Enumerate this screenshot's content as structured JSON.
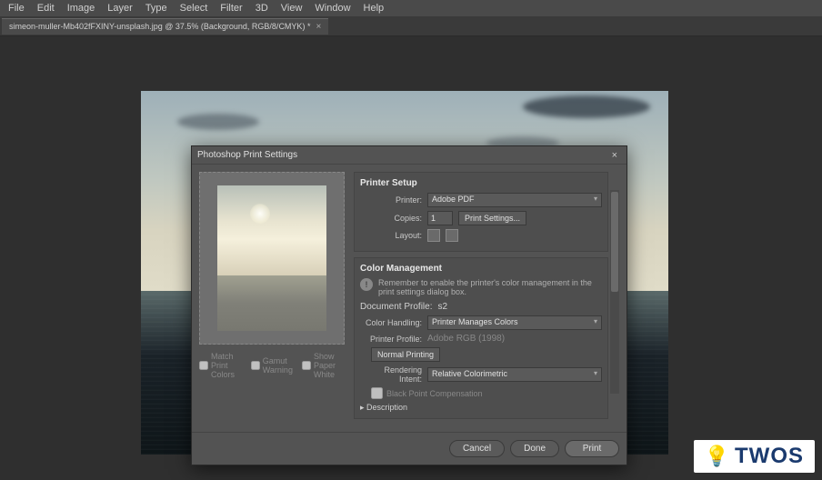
{
  "menubar": {
    "items": [
      "File",
      "Edit",
      "Image",
      "Layer",
      "Type",
      "Select",
      "Filter",
      "3D",
      "View",
      "Window",
      "Help"
    ]
  },
  "tab": {
    "label": "simeon-muller-Mb402fFXINY-unsplash.jpg @ 37.5% (Background, RGB/8/CMYK) *"
  },
  "dialog": {
    "title": "Photoshop Print Settings",
    "printer_setup": {
      "title": "Printer Setup",
      "printer_label": "Printer:",
      "printer_value": "Adobe PDF",
      "copies_label": "Copies:",
      "copies_value": "1",
      "print_settings_btn": "Print Settings...",
      "layout_label": "Layout:"
    },
    "color_mgmt": {
      "title": "Color Management",
      "hint": "Remember to enable the printer's color management in the print settings dialog box.",
      "doc_profile_label": "Document Profile:",
      "doc_profile_value": "s2",
      "color_handling_label": "Color Handling:",
      "color_handling_value": "Printer Manages Colors",
      "printer_profile_label": "Printer Profile:",
      "printer_profile_value": "Adobe RGB (1998)",
      "normal_printing_btn": "Normal Printing",
      "rendering_intent_label": "Rendering Intent:",
      "rendering_intent_value": "Relative Colorimetric",
      "black_point_label": "Black Point Compensation",
      "description_label": "Description"
    },
    "preview": {
      "match_colors": "Match Print Colors",
      "gamut_warning": "Gamut Warning",
      "show_paper_white": "Show Paper White"
    },
    "buttons": {
      "cancel": "Cancel",
      "done": "Done",
      "print": "Print"
    }
  },
  "watermark": {
    "text": "TWOS"
  }
}
